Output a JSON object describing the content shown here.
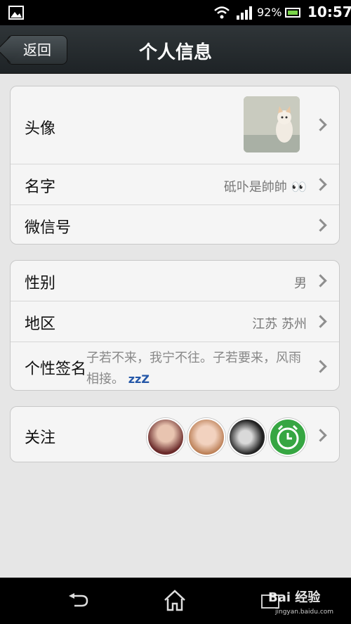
{
  "status_bar": {
    "battery": "92%",
    "time": "10:57"
  },
  "nav": {
    "back_label": "返回",
    "title": "个人信息"
  },
  "section1": {
    "avatar_label": "头像",
    "name_label": "名字",
    "name_value": "砥卟是帥帥 👀",
    "wechat_id_label": "微信号"
  },
  "section2": {
    "gender_label": "性别",
    "gender_value": "男",
    "region_label": "地区",
    "region_value": "江苏 苏州",
    "signature_label": "个性签名",
    "signature_value": "子若不来，我宁不往。子若要来，风雨相接。",
    "signature_emoji": "zzZ"
  },
  "section3": {
    "follow_label": "关注"
  },
  "watermark": {
    "text": "Bai 经验",
    "sub": "jingyan.baidu.com"
  },
  "icons": [
    "gallery-icon",
    "wifi-icon",
    "signal-icon",
    "battery-icon",
    "chevron-right-icon",
    "back-nav-icon",
    "home-icon",
    "recent-apps-icon"
  ]
}
